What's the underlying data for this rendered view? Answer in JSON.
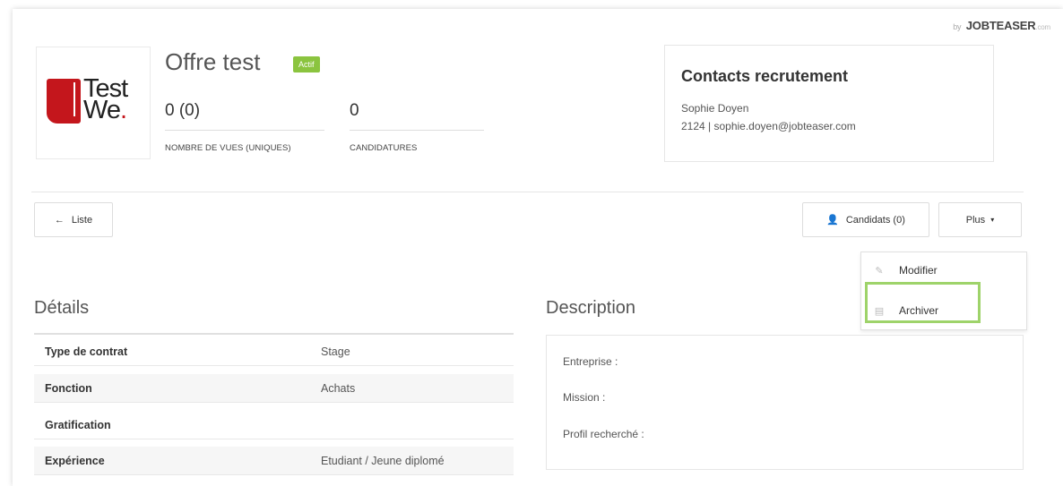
{
  "brand": {
    "by": "by",
    "name": "JOBTEASER",
    "domain": ".com"
  },
  "logo": {
    "line1": "Test",
    "line2": "We",
    "dot": "."
  },
  "offer": {
    "title": "Offre test",
    "status": "Actif",
    "views_value": "0 (0)",
    "views_label": "NOMBRE DE VUES (UNIQUES)",
    "applications_value": "0",
    "applications_label": "CANDIDATURES"
  },
  "contacts": {
    "title": "Contacts recrutement",
    "name": "Sophie Doyen",
    "details": "2124 | sophie.doyen@jobteaser.com"
  },
  "toolbar": {
    "back_label": "Liste",
    "candidates_label": "Candidats (0)",
    "more_label": "Plus"
  },
  "more_menu": {
    "edit_label": "Modifier",
    "archive_label": "Archiver"
  },
  "details": {
    "title": "Détails",
    "rows": [
      {
        "label": "Type de contrat",
        "value": "Stage"
      },
      {
        "label": "Fonction",
        "value": "Achats"
      },
      {
        "label": "Gratification",
        "value": ""
      },
      {
        "label": "Expérience",
        "value": "Etudiant / Jeune diplomé"
      }
    ]
  },
  "description": {
    "title": "Description",
    "company_label": "Entreprise :",
    "mission_label": "Mission :",
    "profile_label": "Profil recherché :"
  },
  "colors": {
    "status_badge": "#8bc43f",
    "highlight": "#9ed36a",
    "logo_red": "#c4161c"
  }
}
